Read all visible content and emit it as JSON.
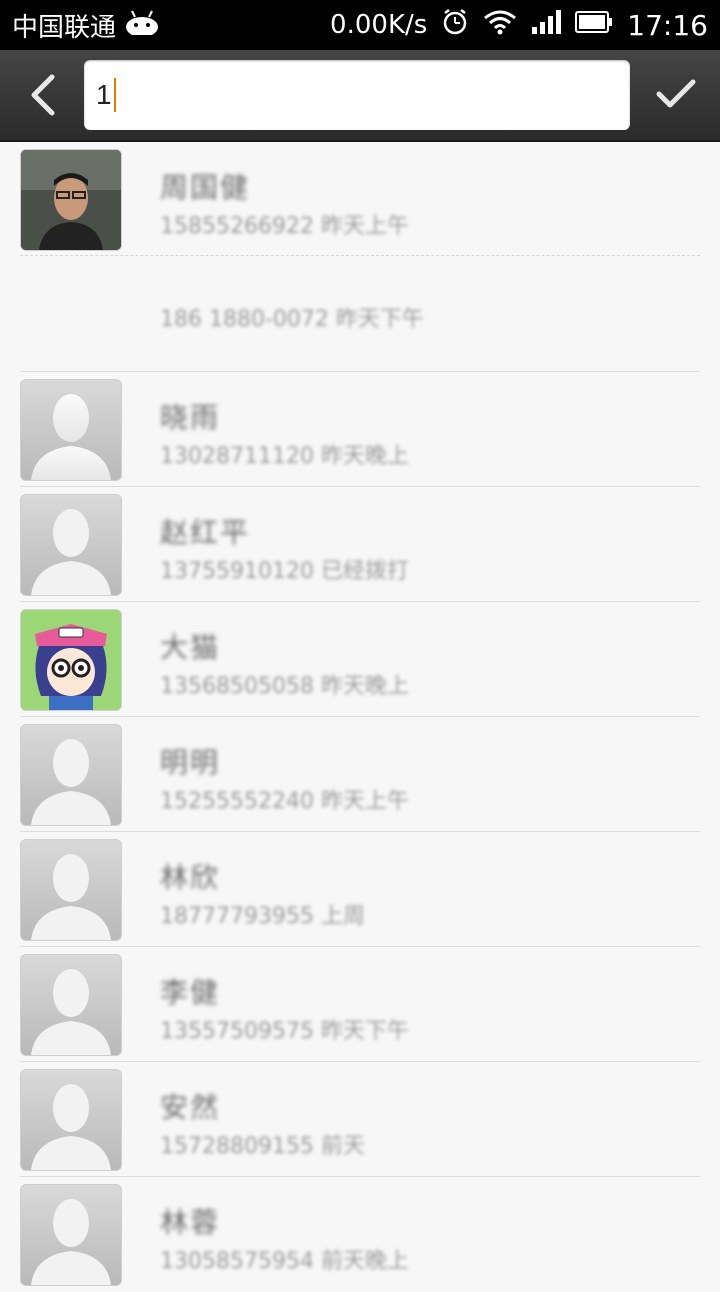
{
  "status_bar": {
    "carrier": "中国联通",
    "speed": "0.00K/s",
    "time": "17:16"
  },
  "search": {
    "query": "1"
  },
  "contacts": [
    {
      "name": "周国健",
      "detail": "15855266922 昨天上午",
      "avatar": "photo-man"
    },
    {
      "name": "",
      "detail": "186 1880-0072 昨天下午",
      "avatar": "none"
    },
    {
      "name": "晓雨",
      "detail": "13028711120 昨天晚上",
      "avatar": "default"
    },
    {
      "name": "赵红平",
      "detail": "13755910120 已经拨打",
      "avatar": "default"
    },
    {
      "name": "大猫",
      "detail": "13568505058 昨天晚上",
      "avatar": "cartoon"
    },
    {
      "name": "明明",
      "detail": "15255552240 昨天上午",
      "avatar": "default"
    },
    {
      "name": "林欣",
      "detail": "18777793955 上周",
      "avatar": "default"
    },
    {
      "name": "李健",
      "detail": "13557509575 昨天下午",
      "avatar": "default"
    },
    {
      "name": "安然",
      "detail": "15728809155 前天",
      "avatar": "default"
    },
    {
      "name": "林蓉",
      "detail": "13058575954 前天晚上",
      "avatar": "default"
    }
  ]
}
